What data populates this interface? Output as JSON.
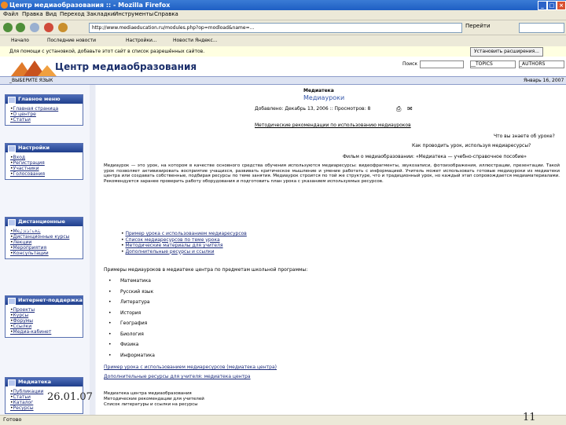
{
  "window": {
    "title": "Центр медиаобразования :: - Mozilla Firefox"
  },
  "menu": [
    "Файл",
    "Правка",
    "Вид",
    "Переход",
    "Закладки",
    "Инструменты",
    "Справка"
  ],
  "nav": {
    "url": "http://www.mediaeducation.ru/modules.php?op=modload&name=...",
    "go_label": "Перейти"
  },
  "bookmarks": [
    "Начало",
    "Последние новости",
    "Настройки...",
    "Новости Яндекс..."
  ],
  "infobar": {
    "text": "Для помощи с установкой, добавьте этот сайт в список разрешённых сайтов.",
    "button": "Установить расширения..."
  },
  "site": {
    "title": "Центр медиаобразования",
    "search_label": "Поиск",
    "topics": "__TOPICS",
    "authors": "_AUTHORS",
    "stripe_left": "_ВЫБЕРИТЕ ЯЗЫК",
    "stripe_right": "Январь 16, 2007"
  },
  "sidebar": [
    {
      "title": "Главное меню",
      "items": [
        "Главная страница",
        "О центре",
        "Статьи"
      ]
    },
    {
      "title": "Настройки",
      "items": [
        "Вход",
        "Регистрация",
        "Участники",
        "Голосования"
      ]
    },
    {
      "title": "Дистанционные проекты",
      "items": [
        "Медиатека",
        "Дистанционные курсы",
        "Лекции",
        "Мероприятия",
        "Консультации"
      ]
    },
    {
      "title": "Интернет-поддержка",
      "items": [
        "Проекты",
        "Курсы",
        "Форумы",
        "Ссылки",
        "Медиа-кабинет"
      ]
    },
    {
      "title": "Медиатека",
      "items": [
        "Публикации",
        "Статьи",
        "Каталог",
        "Ресурсы"
      ]
    }
  ],
  "article": {
    "section": "Медиатека",
    "title": "Медиауроки",
    "meta": "Добавлено: Декабрь 13, 2006 :: Просмотров: 8",
    "subtitle": "Методические рекомендации по использованию медиауроков",
    "q1": "Что вы знаете об уроке?",
    "q2": "Как проводить урок, используя медиаресурсы?",
    "q3": "Фильм о медиаобразовании: «Медиатека — учебно-справочное пособие»",
    "body": "Медиаурок — это урок, на котором в качестве основного средства обучения используются медиаресурсы: видеофрагменты, звукозаписи, фотоизображения, иллюстрации, презентации. Такой урок позволяет активизировать восприятие учащихся, развивать критическое мышление и умение работать с информацией. Учитель может использовать готовые медиауроки из медиатеки центра или создавать собственные, подбирая ресурсы по теме занятия. Медиаурок строится по той же структуре, что и традиционный урок, но каждый этап сопровождается медиаматериалами. Рекомендуется заранее проверить работу оборудования и подготовить план урока с указанием используемых ресурсов.",
    "links": [
      "Пример урока с использованием медиаресурсов",
      "Список медиаресурсов по теме урока",
      "Методические материалы для учителя",
      "Дополнительные ресурсы и ссылки"
    ],
    "intro2": "Примеры медиауроков в медиатеке центра по предметам школьной программы:",
    "items": [
      "Математика",
      "Русский язык",
      "Литература",
      "История",
      "География",
      "Биология",
      "Физика",
      "Информатика"
    ],
    "footer_link1": "Пример урока с использованием медиаресурсов (медиатека центра)",
    "footer_link2": "Дополнительные ресурсы для учителя: медиатека центра",
    "footer_lines": [
      "Медиатека центра медиаобразования",
      "Методические рекомендации для учителей",
      "Список литературы и ссылки на ресурсы"
    ]
  },
  "status": "Готово",
  "slide": {
    "date": "26.01.07",
    "page": "11"
  }
}
